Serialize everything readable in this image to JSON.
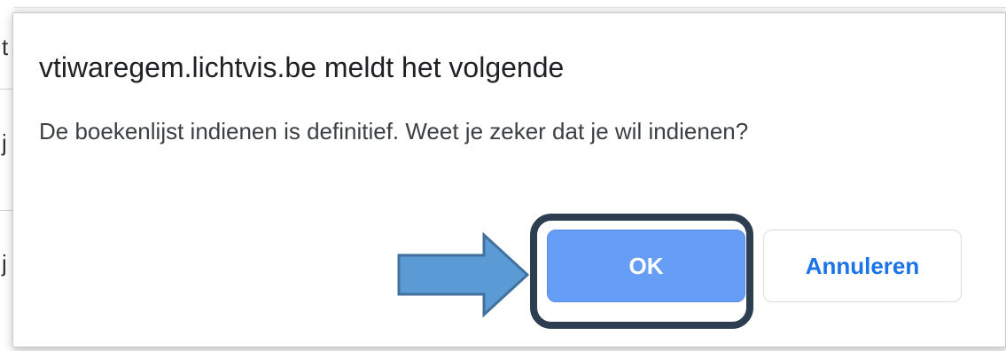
{
  "background": {
    "edge_glyphs": [
      "t",
      "j",
      "j"
    ]
  },
  "dialog": {
    "title": "vtiwaregem.lichtvis.be meldt het volgende",
    "message": "De boekenlijst indienen is definitief. Weet je zeker dat je wil indienen?",
    "ok_label": "OK",
    "cancel_label": "Annuleren"
  },
  "annotation": {
    "arrow_icon": "right-arrow-icon",
    "arrow_color": "#5b9bd5",
    "highlight_color": "#2c3e50"
  },
  "colors": {
    "ok_background": "#669df6",
    "cancel_text": "#1a73e8",
    "title_text": "#202124",
    "message_text": "#3c4043"
  }
}
